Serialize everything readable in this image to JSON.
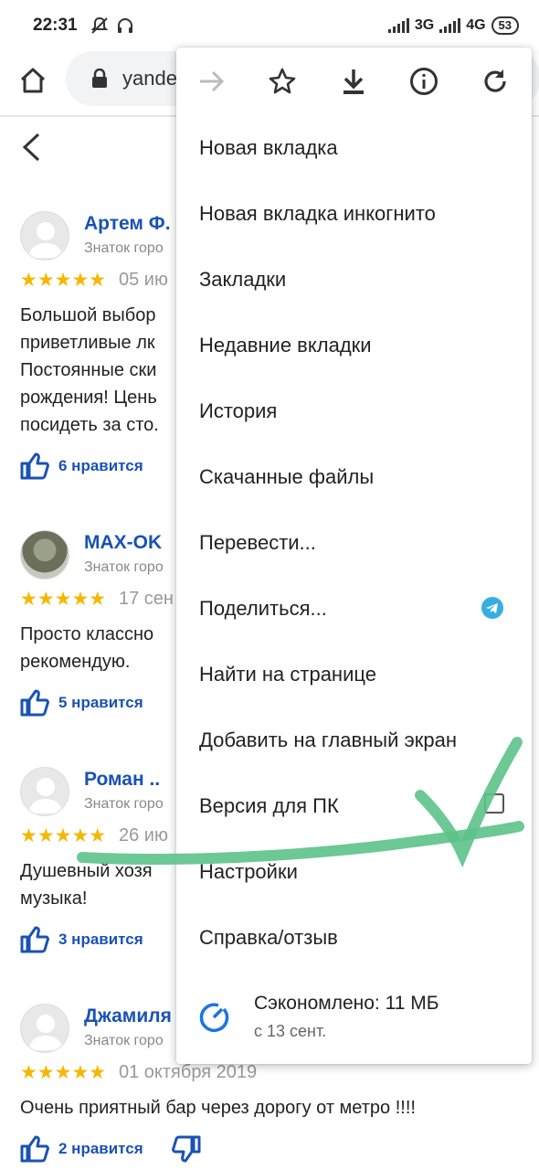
{
  "status_bar": {
    "time": "22:31",
    "net1": "3G",
    "net2": "4G",
    "battery": "53"
  },
  "browser": {
    "url": "yande"
  },
  "reviews": [
    {
      "name": "Артем Ф.",
      "rank": "Знаток горо",
      "stars": "★★★★★",
      "date": "05 ию",
      "text_lines": [
        "Большой выбор",
        "приветливые лк",
        "Постоянные ски",
        "рождения! Цень",
        "посидеть за сто."
      ],
      "likes": "6 нравится"
    },
    {
      "name": "MAX-OK",
      "rank": "Знаток горо",
      "stars": "★★★★★",
      "date": "17 сен",
      "text_lines": [
        "Просто классно",
        "рекомендую."
      ],
      "likes": "5 нравится"
    },
    {
      "name": "Роман ..",
      "rank": "Знаток горо",
      "stars": "★★★★★",
      "date": "26 ию",
      "text_lines": [
        "Душевный хозя",
        "музыка!"
      ],
      "likes": "3 нравится"
    },
    {
      "name": "Джамиля",
      "rank": "Знаток горо",
      "stars": "★★★★★",
      "date": "01 октября 2019",
      "text_lines": [
        "Очень приятный бар через дорогу от метро !!!!"
      ],
      "likes": "2 нравится"
    }
  ],
  "menu": {
    "toolbar_icons": [
      "forward-icon",
      "bookmark-star-icon",
      "download-icon",
      "info-icon",
      "reload-icon"
    ],
    "items": [
      {
        "label": "Новая вкладка"
      },
      {
        "label": "Новая вкладка инкогнито"
      },
      {
        "label": "Закладки"
      },
      {
        "label": "Недавние вкладки"
      },
      {
        "label": "История"
      },
      {
        "label": "Скачанные файлы"
      },
      {
        "label": "Перевести..."
      },
      {
        "label": "Поделиться...",
        "trailing_icon": "telegram-icon"
      },
      {
        "label": "Найти на странице"
      },
      {
        "label": "Добавить на главный экран"
      },
      {
        "label": "Версия для ПК",
        "checkbox": false
      },
      {
        "label": "Настройки"
      },
      {
        "label": "Справка/отзыв"
      }
    ],
    "data_saver": {
      "line1": "Сэкономлено: 11 МБ",
      "line2": "с 13 сент."
    }
  },
  "colors": {
    "link_blue": "#1a52b4",
    "star": "#f5b700",
    "scribble": "#5cc28a",
    "menu_icon": "#333333"
  }
}
